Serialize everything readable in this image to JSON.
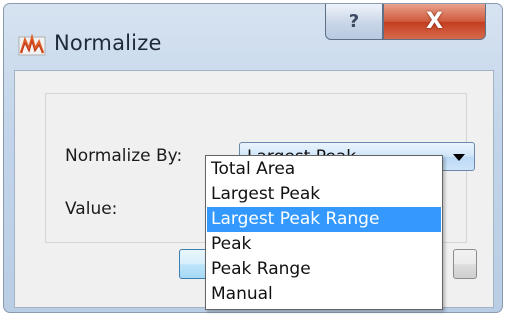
{
  "window": {
    "title": "Normalize",
    "help_glyph": "?",
    "close_glyph": "X"
  },
  "form": {
    "normalize_by_label": "Normalize By:",
    "value_label": "Value:",
    "combo_selected": "Largest Peak"
  },
  "dropdown": {
    "options": [
      "Total Area",
      "Largest Peak",
      "Largest Peak Range",
      "Peak",
      "Peak Range",
      "Manual"
    ],
    "highlighted": "Largest Peak Range"
  },
  "colors": {
    "highlight": "#3399ff",
    "close_button": "#c33d20"
  }
}
